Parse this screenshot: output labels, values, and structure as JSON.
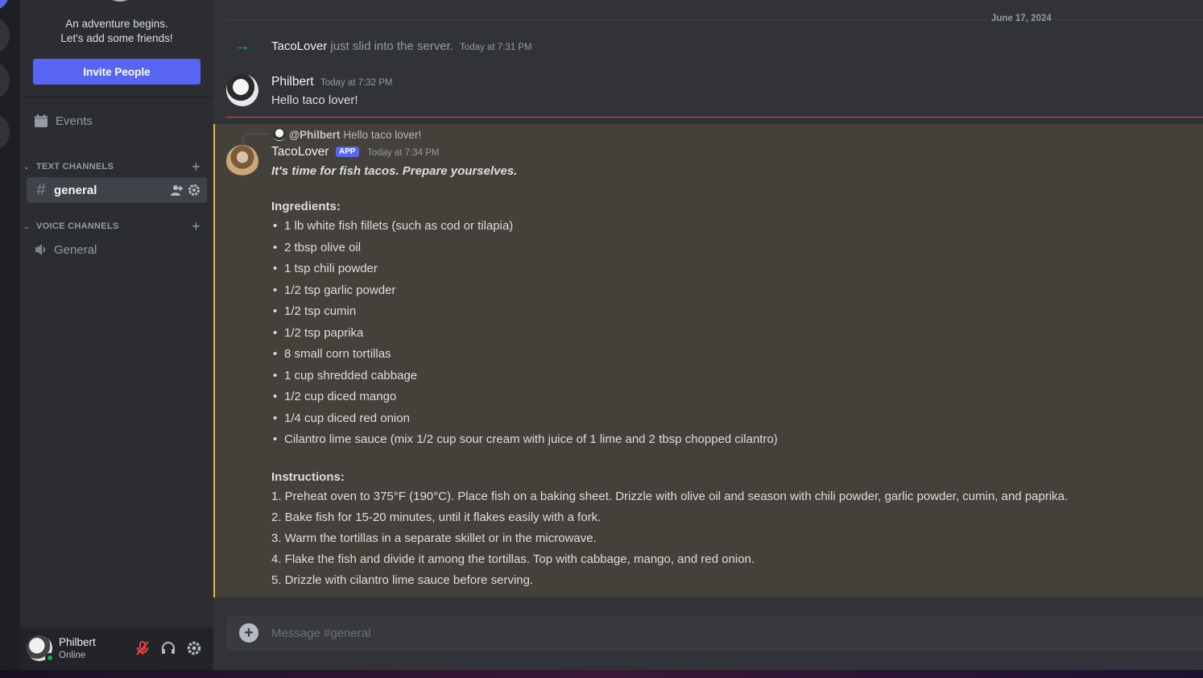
{
  "server": {
    "welcome_line1": "An adventure begins.",
    "welcome_line2": "Let's add some friends!",
    "invite_label": "Invite People",
    "events_label": "Events"
  },
  "categories": {
    "text": "TEXT CHANNELS",
    "voice": "VOICE CHANNELS"
  },
  "channels": {
    "text": [
      {
        "name": "general",
        "selected": true
      }
    ],
    "voice": [
      {
        "name": "General"
      }
    ]
  },
  "user": {
    "name": "Philbert",
    "status": "Online"
  },
  "chat": {
    "date_divider": "June 17, 2024",
    "join": {
      "user": "TacoLover",
      "text": "just slid into the server.",
      "timestamp": "Today at 7:31 PM"
    },
    "message1": {
      "author": "Philbert",
      "timestamp": "Today at 7:32 PM",
      "content": "Hello taco lover!"
    },
    "message2": {
      "reply_author": "@Philbert",
      "reply_text": "Hello taco lover!",
      "author": "TacoLover",
      "badge": "APP",
      "timestamp": "Today at 7:34 PM",
      "intro": "It's time for fish tacos. Prepare yourselves.",
      "ingredients_heading": "Ingredients:",
      "ingredients": [
        "1 lb white fish fillets (such as cod or tilapia)",
        "2 tbsp olive oil",
        "1 tsp chili powder",
        "1/2 tsp garlic powder",
        "1/2 tsp cumin",
        "1/2 tsp paprika",
        "8 small corn tortillas",
        "1 cup shredded cabbage",
        "1/2 cup diced mango",
        "1/4 cup diced red onion",
        "Cilantro lime sauce (mix 1/2 cup sour cream with juice of 1 lime and 2 tbsp chopped cilantro)"
      ],
      "instructions_heading": "Instructions:",
      "instructions": [
        "1. Preheat oven to 375°F (190°C). Place fish on a baking sheet. Drizzle with olive oil and season with chili powder, garlic powder, cumin, and paprika.",
        "2. Bake fish for 15-20 minutes, until it flakes easily with a fork.",
        "3. Warm the tortillas in a separate skillet or in the microwave.",
        "4. Flake the fish and divide it among the tortillas. Top with cabbage, mango, and red onion.",
        "5. Drizzle with cilantro lime sauce before serving."
      ]
    },
    "composer_placeholder": "Message #general"
  },
  "colors": {
    "accent": "#5865f2",
    "mention_highlight": "#f0b232",
    "new_divider": "#f23f43",
    "online": "#23a55a"
  }
}
